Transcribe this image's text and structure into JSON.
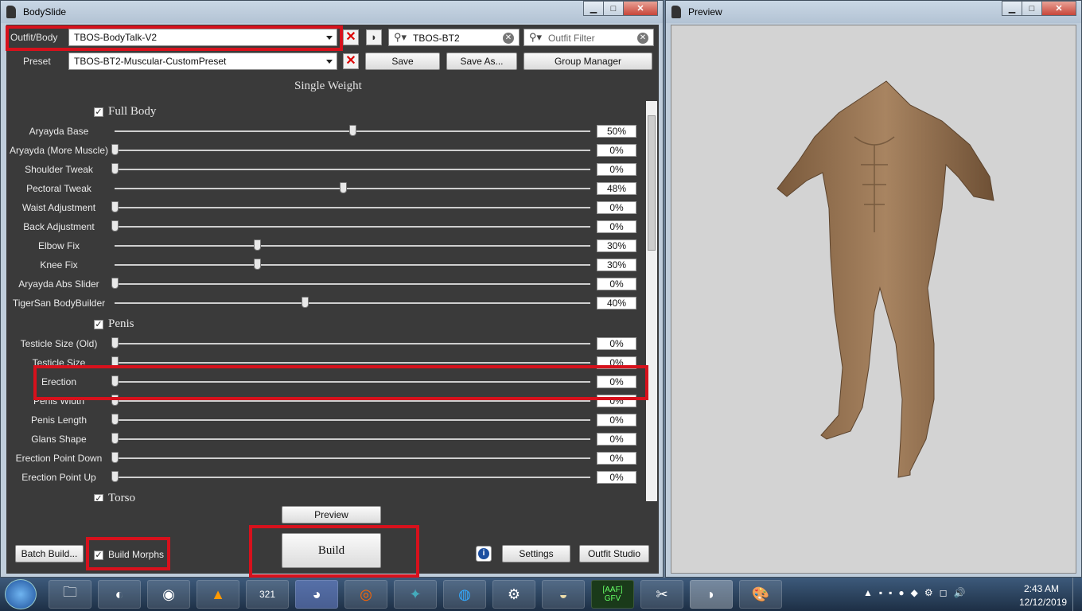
{
  "bodyslide": {
    "title": "BodySlide",
    "min": "▁",
    "max": "□",
    "close": "✕"
  },
  "outfit": {
    "label": "Outfit/Body",
    "value": "TBOS-BodyTalk-V2"
  },
  "preset": {
    "label": "Preset",
    "value": "TBOS-BT2-Muscular-CustomPreset"
  },
  "search1": {
    "value": "TBOS-BT2"
  },
  "search2": {
    "placeholder": "Outfit Filter"
  },
  "buttons": {
    "save": "Save",
    "save_as": "Save As...",
    "group_manager": "Group Manager",
    "preview": "Preview",
    "build": "Build",
    "batch_build": "Batch Build...",
    "settings": "Settings",
    "outfit_studio": "Outfit Studio",
    "build_morphs": "Build Morphs"
  },
  "heading": "Single Weight",
  "groups": {
    "full_body": "Full Body",
    "penis": "Penis",
    "torso": "Torso"
  },
  "sliders": [
    {
      "name": "Aryayda Base",
      "value": 50,
      "label": "50%"
    },
    {
      "name": "Aryayda (More Muscle)",
      "value": 0,
      "label": "0%"
    },
    {
      "name": "Shoulder Tweak",
      "value": 0,
      "label": "0%"
    },
    {
      "name": "Pectoral Tweak",
      "value": 48,
      "label": "48%"
    },
    {
      "name": "Waist Adjustment",
      "value": 0,
      "label": "0%"
    },
    {
      "name": "Back Adjustment",
      "value": 0,
      "label": "0%"
    },
    {
      "name": "Elbow Fix",
      "value": 30,
      "label": "30%"
    },
    {
      "name": "Knee Fix",
      "value": 30,
      "label": "30%"
    },
    {
      "name": "Aryayda Abs Slider",
      "value": 0,
      "label": "0%"
    },
    {
      "name": "TigerSan BodyBuilder",
      "value": 40,
      "label": "40%"
    },
    {
      "name": "Testicle Size (Old)",
      "value": 0,
      "label": "0%"
    },
    {
      "name": "Testicle Size",
      "value": 0,
      "label": "0%"
    },
    {
      "name": "Erection",
      "value": 0,
      "label": "0%"
    },
    {
      "name": "Penis Width",
      "value": 0,
      "label": "0%"
    },
    {
      "name": "Penis Length",
      "value": 0,
      "label": "0%"
    },
    {
      "name": "Glans Shape",
      "value": 0,
      "label": "0%"
    },
    {
      "name": "Erection Point Down",
      "value": 0,
      "label": "0%"
    },
    {
      "name": "Erection Point Up",
      "value": 0,
      "label": "0%"
    }
  ],
  "preview_window": {
    "title": "Preview"
  },
  "taskbar": {
    "time": "2:43 AM",
    "date": "12/12/2019",
    "apps": [
      "explorer-icon",
      "firefox-icon",
      "chrome-icon",
      "vlc-icon",
      "321-icon",
      "discord-icon",
      "origin-icon",
      "battlenet-icon",
      "uplay-icon",
      "steam-icon",
      "wireshark-icon",
      "aaf-gfv-icon",
      "paint-icon",
      "bodyslide-icon",
      "paint2-icon"
    ],
    "aaf_label": "[AAF]\nGFV",
    "cal_label": "321"
  },
  "colors": {
    "highlight": "#d7111c",
    "panel": "#3a3a3a"
  }
}
